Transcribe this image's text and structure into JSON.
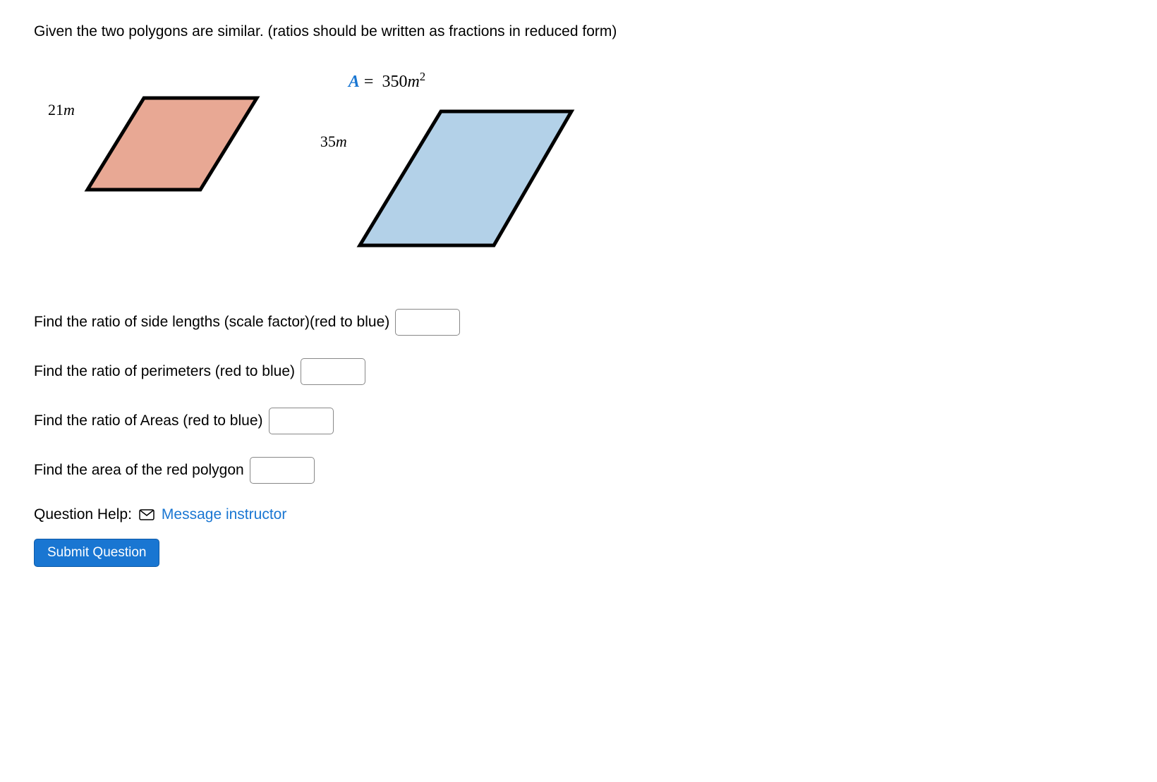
{
  "instruction": "Given the two polygons are similar. (ratios should be written as fractions in reduced form)",
  "polygons": {
    "red_side": "21",
    "red_unit": "m",
    "blue_side": "35",
    "blue_unit": "m",
    "area_letter": "A",
    "area_equals": "=",
    "area_value": "350",
    "area_unit": "m",
    "area_exp": "2"
  },
  "questions": {
    "q1_label": "Find the ratio of side lengths (scale factor)(red to blue)",
    "q2_label": "Find the ratio of perimeters (red to blue)",
    "q3_label": "Find the ratio of Areas (red to blue)",
    "q4_label": "Find the area of the red polygon"
  },
  "help": {
    "label": "Question Help:",
    "link": "Message instructor"
  },
  "submit": {
    "label": "Submit Question"
  }
}
